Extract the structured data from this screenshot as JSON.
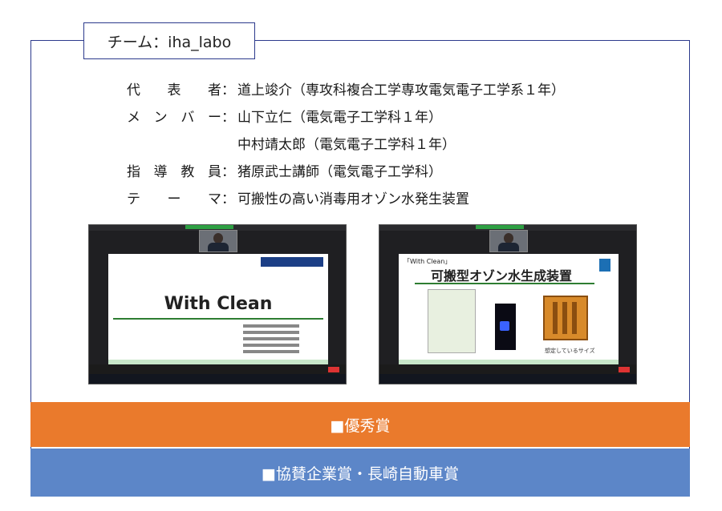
{
  "team": {
    "label": "チーム：iha_labo"
  },
  "info": [
    {
      "key_chars": [
        "代",
        "表",
        "者"
      ],
      "colon": "：",
      "value": "道上竣介（専攻科複合工学専攻電気電子工学系１年）"
    },
    {
      "key_chars": [
        "メ",
        "ン",
        "バ",
        "ー"
      ],
      "colon": "：",
      "value": "山下立仁（電気電子工学科１年）"
    },
    {
      "key_chars": [],
      "colon": "",
      "value": "中村靖太郎（電気電子工学科１年）"
    },
    {
      "key_chars": [
        "指",
        "導",
        "教",
        "員"
      ],
      "colon": "：",
      "value": "猪原武士講師（電気電子工学科）"
    },
    {
      "key_chars": [
        "テ",
        "ー",
        "マ"
      ],
      "colon": "：",
      "value": "可搬性の高い消毒用オゾン水発生装置"
    }
  ],
  "slides": {
    "left_title": "With Clean",
    "right_tag": "「With Clean」",
    "right_title": "可搬型オゾン水生成装置",
    "right_caption": "想定しているサイズ"
  },
  "awards": {
    "first": "■優秀賞",
    "second": "■協賛企業賞・長崎自動車賞"
  },
  "colors": {
    "frame": "#2c3a8c",
    "award_first": "#ea7a2c",
    "award_second": "#5c86c8"
  }
}
